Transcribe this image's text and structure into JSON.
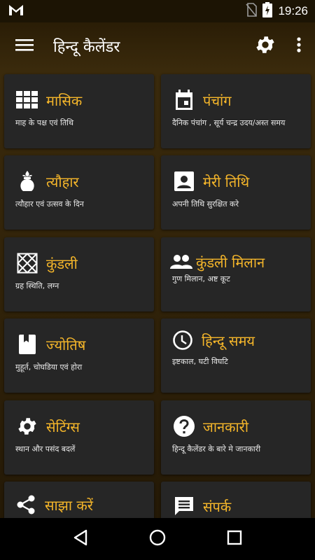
{
  "status_bar": {
    "time": "19:26"
  },
  "app_bar": {
    "title": "हिन्दू कैलेंडर"
  },
  "cards": [
    {
      "title": "मासिक",
      "subtitle": "माह के पक्ष एवं तिथि",
      "icon": "grid-icon"
    },
    {
      "title": "पंचांग",
      "subtitle": "दैनिक पंचांग , सूर्य चन्द्र उदय/अस्त समय",
      "icon": "calendar-icon"
    },
    {
      "title": "त्यौहार",
      "subtitle": "त्यौहार एवं उत्सव के दिन",
      "icon": "kalash-icon"
    },
    {
      "title": "मेरी तिथि",
      "subtitle": "अपनी तिथि सुरक्षित करे",
      "icon": "contact-icon"
    },
    {
      "title": "कुंडली",
      "subtitle": "ग्रह स्थिति, लग्न",
      "icon": "kundli-icon"
    },
    {
      "title": "कुंडली मिलान",
      "subtitle": "गुण मिलान, अष्ट कूट",
      "icon": "people-icon"
    },
    {
      "title": "ज्योतिष",
      "subtitle": "मुहूर्त, चोघडिया एवं होरा",
      "icon": "book-icon"
    },
    {
      "title": "हिन्दू समय",
      "subtitle": "इष्टकाल, घटी विघटि",
      "icon": "clock-icon"
    },
    {
      "title": "सेटिंग्स",
      "subtitle": "स्थान और पसंद बदलें",
      "icon": "gear-icon"
    },
    {
      "title": "जानकारी",
      "subtitle": "हिन्दू कैलेंडर के बारे मे जानकारी",
      "icon": "help-icon"
    },
    {
      "title": "साझा करें",
      "subtitle": "",
      "icon": "share-icon"
    },
    {
      "title": "संपर्क",
      "subtitle": "",
      "icon": "message-icon"
    }
  ],
  "colors": {
    "accent": "#f5b62a",
    "card_bg": "#262626",
    "background": "#3a2a0c"
  }
}
